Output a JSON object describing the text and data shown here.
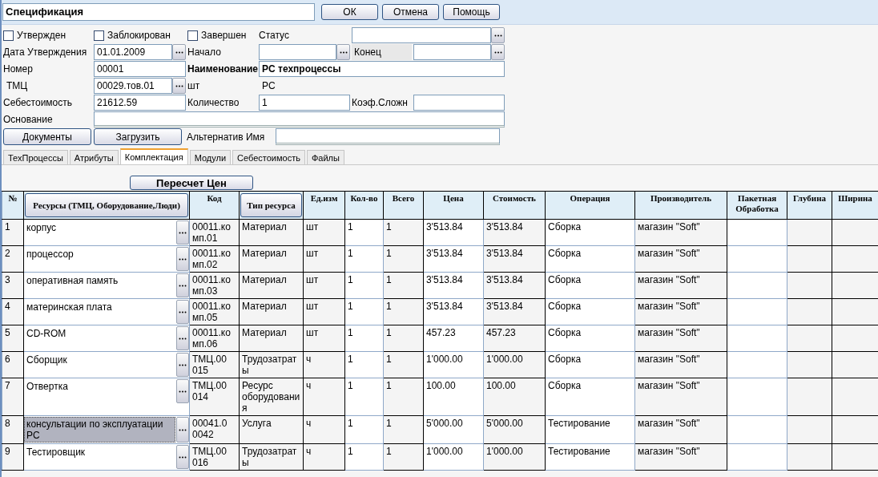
{
  "window": {
    "title": "Спецификация"
  },
  "dialog_buttons": [
    "ОК",
    "Отмена",
    "Помощь"
  ],
  "flags": [
    {
      "label": "Утвержден",
      "checked": false
    },
    {
      "label": "Заблокирован",
      "checked": false
    },
    {
      "label": "Завершен",
      "checked": false
    }
  ],
  "form": {
    "status": {
      "label": "Статус"
    },
    "approval_date": {
      "label": "Дата Утверждения",
      "value": "01.01.2009"
    },
    "start": {
      "label": "Начало"
    },
    "end": {
      "label": "Конец"
    },
    "number": {
      "label": "Номер",
      "value": "00001"
    },
    "name": {
      "label": "Наименование",
      "value": "PC техпроцессы"
    },
    "item": {
      "label": "ТМЦ",
      "value": "00029.тов.01"
    },
    "unit": {
      "label": "шт",
      "value": "PC"
    },
    "cost": {
      "label": "Себестоимость",
      "value": "21612.59"
    },
    "quantity": {
      "label": "Количество",
      "value": "1"
    },
    "complexity": {
      "label": "Коэф.Сложн"
    },
    "basis": {
      "label": "Основание"
    },
    "alt_name": {
      "label": "Альтернатив Имя"
    }
  },
  "actions": [
    "Документы",
    "Загрузить"
  ],
  "tabs": [
    {
      "label": "ТехПроцессы",
      "selected": false
    },
    {
      "label": "Атрибуты",
      "selected": false
    },
    {
      "label": "Комплектация",
      "selected": true
    },
    {
      "label": "Модули",
      "selected": false
    },
    {
      "label": "Себестоимость",
      "selected": false
    },
    {
      "label": "Файлы",
      "selected": false
    }
  ],
  "recalc_button": "Пересчет Цен",
  "table": {
    "columns": [
      {
        "label": "№",
        "kind": "label",
        "editable": false
      },
      {
        "label": "Ресурсы (ТМЦ, Оборудование,Люди)",
        "kind": "button",
        "editable": true
      },
      {
        "label": "Код",
        "kind": "label",
        "editable": false
      },
      {
        "label": "Тип ресурса",
        "kind": "button",
        "editable": false
      },
      {
        "label": "Ед.изм",
        "kind": "label",
        "editable": false
      },
      {
        "label": "Кол-во",
        "kind": "label",
        "editable": true
      },
      {
        "label": "Всего",
        "kind": "label",
        "editable": false
      },
      {
        "label": "Цена",
        "kind": "label",
        "editable": true
      },
      {
        "label": "Стоимость",
        "kind": "label",
        "editable": false
      },
      {
        "label": "Операция",
        "kind": "label",
        "editable": true
      },
      {
        "label": "Производитель",
        "kind": "label",
        "editable": false
      },
      {
        "label": "Пакетная Обработка",
        "kind": "label",
        "editable": true
      },
      {
        "label": "Глубина",
        "kind": "label",
        "editable": false
      },
      {
        "label": "Ширина",
        "kind": "label",
        "editable": false
      }
    ],
    "rows": [
      {
        "selected": false,
        "cells": [
          "1",
          "корпус",
          "00011.комп.01",
          "Материал",
          "шт",
          "1",
          "1",
          "3'513.84",
          "3'513.84",
          "Сборка",
          "магазин \"Soft\""
        ]
      },
      {
        "selected": false,
        "cells": [
          "2",
          "процессор",
          "00011.комп.02",
          "Материал",
          "шт",
          "1",
          "1",
          "3'513.84",
          "3'513.84",
          "Сборка",
          "магазин \"Soft\""
        ]
      },
      {
        "selected": false,
        "cells": [
          "3",
          "оперативная память",
          "00011.комп.03",
          "Материал",
          "шт",
          "1",
          "1",
          "3'513.84",
          "3'513.84",
          "Сборка",
          "магазин \"Soft\""
        ]
      },
      {
        "selected": false,
        "cells": [
          "4",
          "материнская плата",
          "00011.комп.05",
          "Материал",
          "шт",
          "1",
          "1",
          "3'513.84",
          "3'513.84",
          "Сборка",
          "магазин \"Soft\""
        ]
      },
      {
        "selected": false,
        "cells": [
          "5",
          "CD-ROM",
          "00011.комп.06",
          "Материал",
          "шт",
          "1",
          "1",
          "457.23",
          "457.23",
          "Сборка",
          "магазин \"Soft\""
        ]
      },
      {
        "selected": false,
        "cells": [
          "6",
          "Сборщик",
          "ТМЦ.00015",
          "Трудозатраты",
          "ч",
          "1",
          "1",
          "1'000.00",
          "1'000.00",
          "Сборка",
          "магазин \"Soft\""
        ]
      },
      {
        "selected": false,
        "cells": [
          "7",
          "Отвертка",
          "ТМЦ.00014",
          "Ресурс оборудования",
          "ч",
          "1",
          "1",
          "100.00",
          "100.00",
          "Сборка",
          "магазин \"Soft\""
        ]
      },
      {
        "selected": true,
        "cells": [
          "8",
          "консультации по эксплуатации PC",
          "00041.00042",
          "Услуга",
          "ч",
          "1",
          "1",
          "5'000.00",
          "5'000.00",
          "Тестирование",
          "магазин \"Soft\""
        ]
      },
      {
        "selected": false,
        "cells": [
          "9",
          "Тестировщик",
          "ТМЦ.00016",
          "Трудозатраты",
          "ч",
          "1",
          "1",
          "1'000.00",
          "1'000.00",
          "Тестирование",
          "магазин \"Soft\""
        ]
      }
    ]
  }
}
